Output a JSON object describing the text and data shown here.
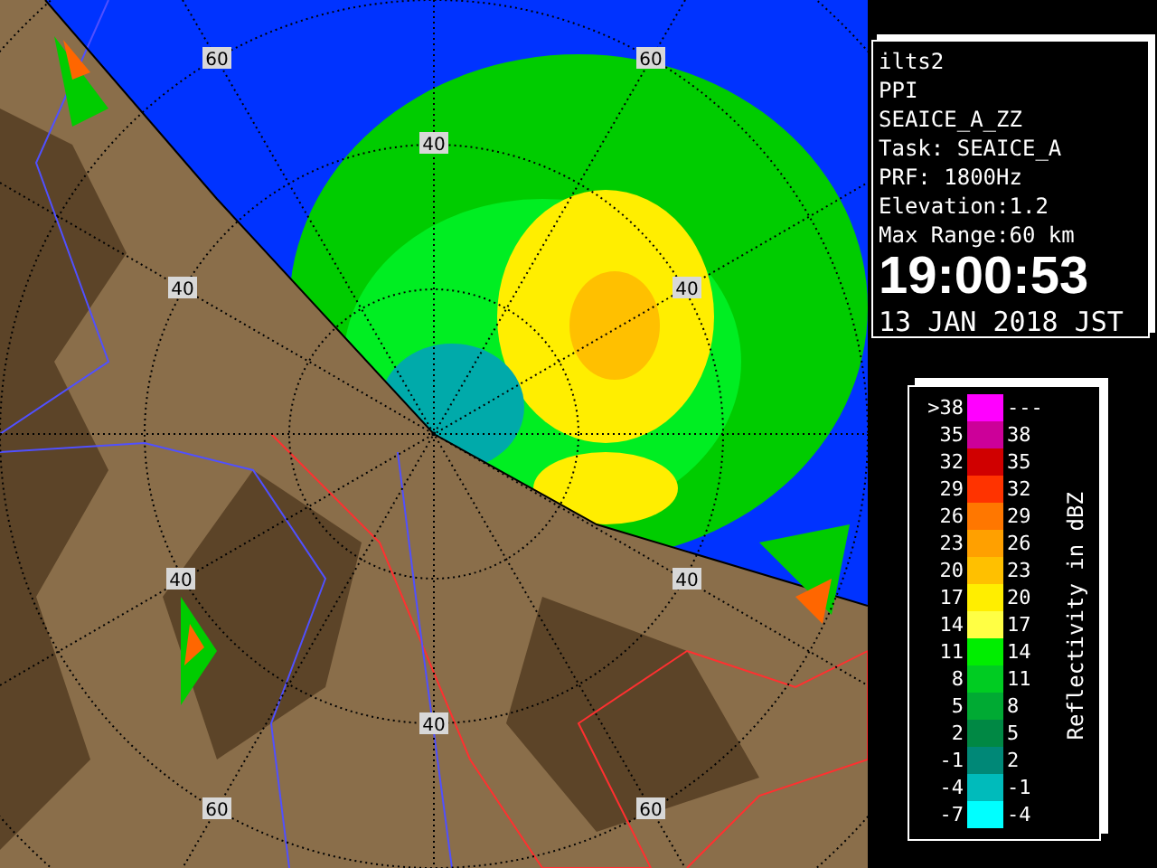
{
  "map": {
    "range_labels": [
      "60",
      "60",
      "40",
      "40",
      "40",
      "40",
      "40",
      "40",
      "60",
      "60"
    ]
  },
  "info": {
    "lines": [
      "ilts2",
      "PPI",
      "SEAICE_A_ZZ",
      "Task: SEAICE_A",
      "PRF: 1800Hz",
      "Elevation:1.2",
      "Max Range:60 km"
    ],
    "time": "19:00:53",
    "date": "13 JAN 2018 JST"
  },
  "legend": {
    "title": "Reflectivity in dBZ",
    "rows": [
      {
        "low": ">38",
        "high": "---",
        "color": "#ff00ff"
      },
      {
        "low": "35",
        "high": "38",
        "color": "#cc0099"
      },
      {
        "low": "32",
        "high": "35",
        "color": "#d00000"
      },
      {
        "low": "29",
        "high": "32",
        "color": "#ff3300"
      },
      {
        "low": "26",
        "high": "29",
        "color": "#ff7700"
      },
      {
        "low": "23",
        "high": "26",
        "color": "#ffa000"
      },
      {
        "low": "20",
        "high": "23",
        "color": "#ffc000"
      },
      {
        "low": "17",
        "high": "20",
        "color": "#ffee00"
      },
      {
        "low": "14",
        "high": "17",
        "color": "#ffff44"
      },
      {
        "low": "11",
        "high": "14",
        "color": "#00ee00"
      },
      {
        "low": "8",
        "high": "11",
        "color": "#00cc22"
      },
      {
        "low": "5",
        "high": "8",
        "color": "#00aa33"
      },
      {
        "low": "2",
        "high": "5",
        "color": "#008844"
      },
      {
        "low": "-1",
        "high": "2",
        "color": "#008877"
      },
      {
        "low": "-4",
        "high": "-1",
        "color": "#00bbbb"
      },
      {
        "low": "-7",
        "high": "-4",
        "color": "#00ffff"
      }
    ]
  }
}
